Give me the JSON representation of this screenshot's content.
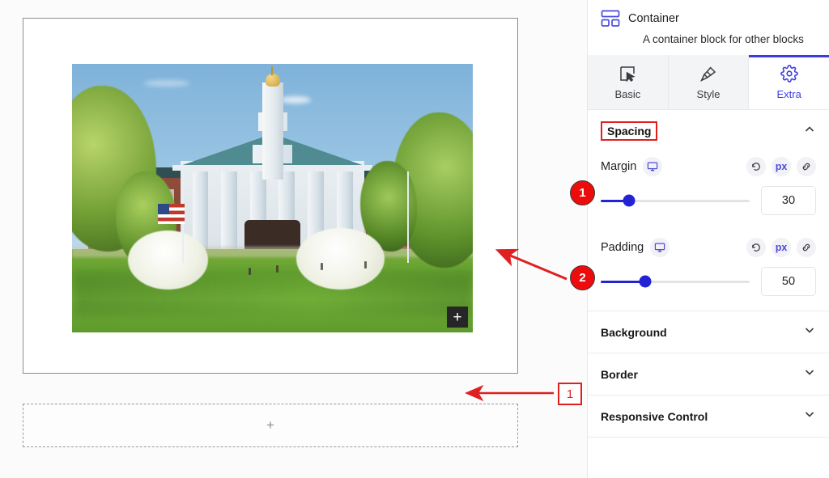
{
  "panel": {
    "block": {
      "icon": "container-blocks-icon",
      "title": "Container",
      "description": "A container block for other blocks"
    },
    "tabs": [
      {
        "label": "Basic",
        "icon": "cursor-select-icon",
        "active": false
      },
      {
        "label": "Style",
        "icon": "paintbrush-icon",
        "active": false
      },
      {
        "label": "Extra",
        "icon": "gear-icon",
        "active": true
      }
    ],
    "spacing": {
      "title": "Spacing",
      "expanded": true,
      "collapse_icon": "chevron-up-icon",
      "highlight_color": "#e02020",
      "fields": [
        {
          "label": "Margin",
          "device_icon": "desktop-monitor-icon",
          "reset_icon": "reset-arrow-icon",
          "unit": "px",
          "link_icon": "link-chain-icon",
          "value": "30",
          "slider_percent": 19
        },
        {
          "label": "Padding",
          "device_icon": "desktop-monitor-icon",
          "reset_icon": "reset-arrow-icon",
          "unit": "px",
          "link_icon": "link-chain-icon",
          "value": "50",
          "slider_percent": 30
        }
      ]
    },
    "accordions": [
      {
        "label": "Background",
        "icon": "chevron-down-icon"
      },
      {
        "label": "Border",
        "icon": "chevron-down-icon"
      },
      {
        "label": "Responsive Control",
        "icon": "chevron-down-icon"
      }
    ]
  },
  "canvas": {
    "image_block": {
      "alt": "University campus building with white columns, golden dome tower, American flag and green lawn",
      "add_button_icon": "plus-icon"
    },
    "drop_zone": {
      "add_icon": "plus-icon"
    },
    "annotations": {
      "accent_color": "#ee0b0b",
      "margin_badge": "1",
      "padding_badge": "2",
      "margin_callout_box": "1"
    }
  }
}
